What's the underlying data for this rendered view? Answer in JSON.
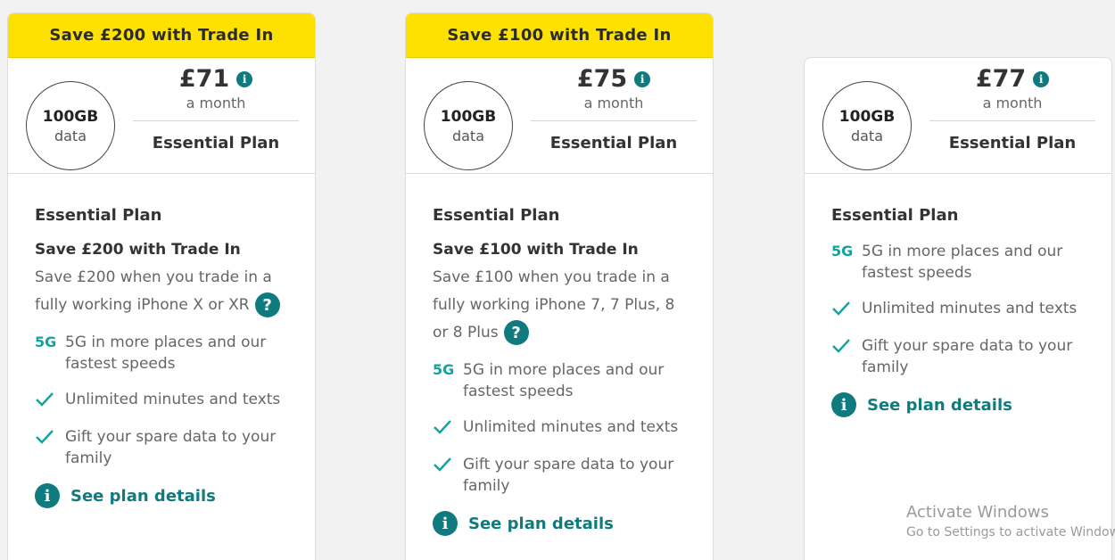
{
  "plans": [
    {
      "promo": "Save £200 with Trade In",
      "data_amount": "100GB",
      "data_label": "data",
      "price": "£71",
      "per_month": "a month",
      "plan_label": "Essential Plan",
      "plan_name": "Essential Plan",
      "trade_title": "Save £200 with Trade In",
      "trade_desc": "Save £200 when you trade in a fully working iPhone X or XR",
      "feature_5g_badge": "5G",
      "feature_5g": "5G in more places and our fastest speeds",
      "feature_minutes": "Unlimited minutes and texts",
      "feature_gift": "Gift your spare data to your family",
      "details_link": "See plan details"
    },
    {
      "promo": "Save £100 with Trade In",
      "data_amount": "100GB",
      "data_label": "data",
      "price": "£75",
      "per_month": "a month",
      "plan_label": "Essential Plan",
      "plan_name": "Essential Plan",
      "trade_title": "Save £100 with Trade In",
      "trade_desc": "Save £100 when you trade in a fully working iPhone 7, 7 Plus, 8 or 8 Plus",
      "feature_5g_badge": "5G",
      "feature_5g": "5G in more places and our fastest speeds",
      "feature_minutes": "Unlimited minutes and texts",
      "feature_gift": "Gift your spare data to your family",
      "details_link": "See plan details"
    },
    {
      "data_amount": "100GB",
      "data_label": "data",
      "price": "£77",
      "per_month": "a month",
      "plan_label": "Essential Plan",
      "plan_name": "Essential Plan",
      "feature_5g_badge": "5G",
      "feature_5g": "5G in more places and our fastest speeds",
      "feature_minutes": "Unlimited minutes and texts",
      "feature_gift": "Gift your spare data to your family",
      "details_link": "See plan details"
    }
  ],
  "icons": {
    "info": "i",
    "help": "?"
  },
  "colors": {
    "promo_bg": "#fde100",
    "accent": "#0f7b7f",
    "feature_5g": "#11a39d"
  },
  "watermark": {
    "line1": "Activate Windows",
    "line2": "Go to Settings to activate Windows."
  }
}
